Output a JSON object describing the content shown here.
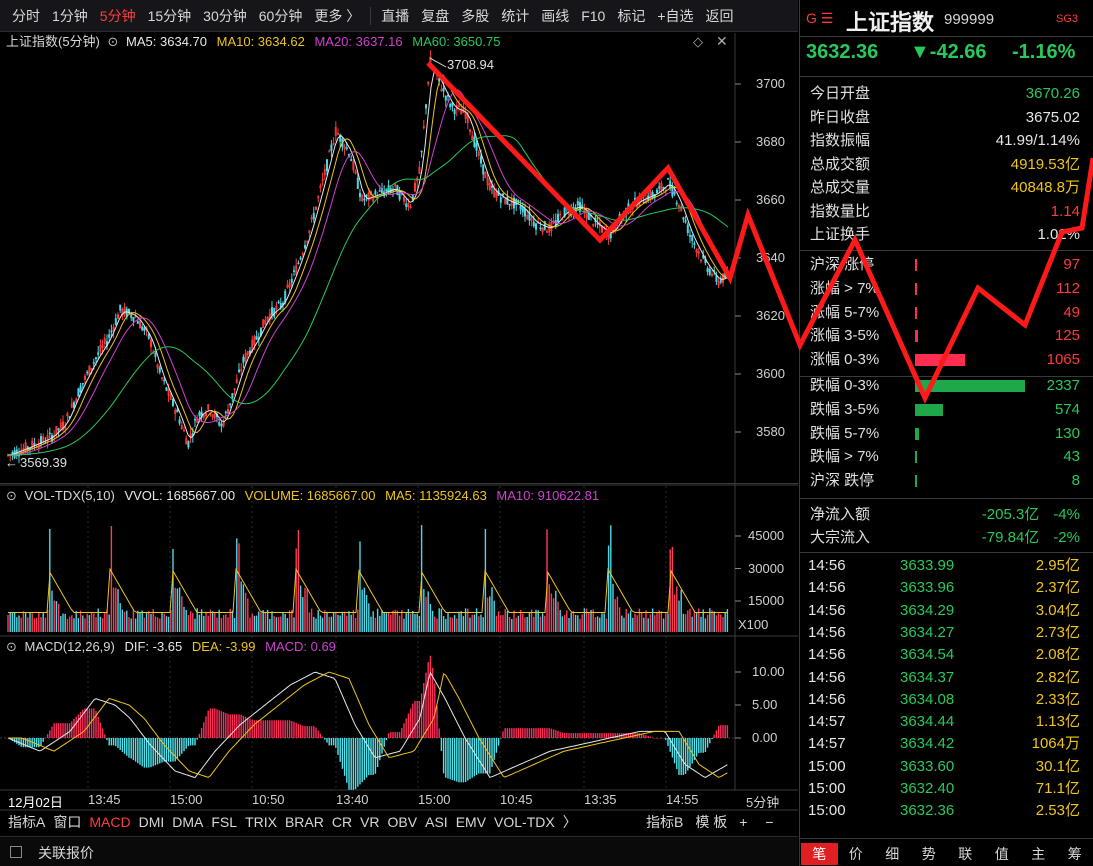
{
  "toolbar": {
    "periods": [
      "分时",
      "1分钟",
      "5分钟",
      "15分钟",
      "30分钟",
      "60分钟",
      "更多 〉"
    ],
    "active_period": "5分钟",
    "actions": [
      "直播",
      "复盘",
      "多股",
      "统计",
      "画线",
      "F10",
      "标记",
      "+自选",
      "返回"
    ]
  },
  "main_legend": {
    "name": "上证指数(5分钟)",
    "ma5": "MA5: 3634.70",
    "ma10": "MA10: 3634.62",
    "ma20": "MA20: 3637.16",
    "ma60": "MA60: 3650.75"
  },
  "price_axis": [
    "3700",
    "3680",
    "3660",
    "3640",
    "3620",
    "3600",
    "3580"
  ],
  "price_labels": {
    "high": "3708.94",
    "low": "3569.39"
  },
  "vol_legend": {
    "name": "VOL-TDX(5,10)",
    "vvol": "VVOL: 1685667.00",
    "volume": "VOLUME: 1685667.00",
    "ma5": "MA5: 1135924.63",
    "ma10": "MA10: 910622.81"
  },
  "vol_axis": [
    "45000",
    "30000",
    "15000"
  ],
  "vol_unit": "X100",
  "macd_legend": {
    "name": "MACD(12,26,9)",
    "dif": "DIF: -3.65",
    "dea": "DEA: -3.99",
    "macd": "MACD: 0.69"
  },
  "macd_axis": [
    "10.00",
    "5.00",
    "0.00"
  ],
  "time_axis": [
    "12月02日",
    "13:45",
    "15:00",
    "10:50",
    "13:40",
    "15:00",
    "10:45",
    "13:35",
    "14:55"
  ],
  "period_label": "5分钟",
  "indicator_tabs": [
    "指标A",
    "窗口",
    "MACD",
    "DMI",
    "DMA",
    "FSL",
    "TRIX",
    "BRAR",
    "CR",
    "VR",
    "OBV",
    "ASI",
    "EMV",
    "VOL-TDX",
    "〉"
  ],
  "active_indicator": "MACD",
  "indicator_right": [
    "指标B",
    "模 板",
    "+",
    "−"
  ],
  "footer": {
    "label": "关联报价"
  },
  "quote": {
    "badge": "G ☰",
    "name": "上证指数",
    "code": "999999",
    "tag": "SG3",
    "price": "3632.36",
    "change": "▼-42.66",
    "pct": "-1.16%",
    "stats": [
      {
        "label": "今日开盘",
        "value": "3670.26",
        "color": "green"
      },
      {
        "label": "昨日收盘",
        "value": "3675.02",
        "color": "white"
      },
      {
        "label": "指数振幅",
        "value": "41.99/1.14%",
        "color": "white"
      },
      {
        "label": "总成交额",
        "value": "4919.53亿",
        "color": "yellow"
      },
      {
        "label": "总成交量",
        "value": "40848.8万",
        "color": "yellow"
      },
      {
        "label": "指数量比",
        "value": "1.14",
        "color": "red"
      },
      {
        "label": "上证换手",
        "value": "1.02%",
        "color": "white"
      }
    ],
    "breadth": [
      {
        "label": "沪深 涨停",
        "value": "97",
        "color": "red",
        "bar": 0.02
      },
      {
        "label": "涨幅 > 7%",
        "value": "112",
        "color": "red",
        "bar": 0.02
      },
      {
        "label": "涨幅 5-7%",
        "value": "49",
        "color": "red",
        "bar": 0.01
      },
      {
        "label": "涨幅 3-5%",
        "value": "125",
        "color": "red",
        "bar": 0.03
      },
      {
        "label": "涨幅 0-3%",
        "value": "1065",
        "color": "red",
        "bar": 0.45
      },
      {
        "label": "跌幅 0-3%",
        "value": "2337",
        "color": "green",
        "bar": 1.0
      },
      {
        "label": "跌幅 3-5%",
        "value": "574",
        "color": "green",
        "bar": 0.25
      },
      {
        "label": "跌幅 5-7%",
        "value": "130",
        "color": "green",
        "bar": 0.04
      },
      {
        "label": "跌幅 > 7%",
        "value": "43",
        "color": "green",
        "bar": 0.01
      },
      {
        "label": "沪深 跌停",
        "value": "8",
        "color": "green",
        "bar": 0.005
      }
    ],
    "flows": [
      {
        "label": "净流入额",
        "value": "-205.3亿",
        "pct": "-4%"
      },
      {
        "label": "大宗流入",
        "value": "-79.84亿",
        "pct": "-2%"
      }
    ],
    "ticks": [
      {
        "t": "14:56",
        "p": "3633.99",
        "a": "2.95亿"
      },
      {
        "t": "14:56",
        "p": "3633.96",
        "a": "2.37亿"
      },
      {
        "t": "14:56",
        "p": "3634.29",
        "a": "3.04亿"
      },
      {
        "t": "14:56",
        "p": "3634.27",
        "a": "2.73亿"
      },
      {
        "t": "14:56",
        "p": "3634.54",
        "a": "2.08亿"
      },
      {
        "t": "14:56",
        "p": "3634.37",
        "a": "2.82亿"
      },
      {
        "t": "14:56",
        "p": "3634.08",
        "a": "2.33亿"
      },
      {
        "t": "14:57",
        "p": "3634.44",
        "a": "1.13亿"
      },
      {
        "t": "14:57",
        "p": "3634.42",
        "a": "1064万"
      },
      {
        "t": "15:00",
        "p": "3633.60",
        "a": "30.1亿"
      },
      {
        "t": "15:00",
        "p": "3632.40",
        "a": "71.1亿"
      },
      {
        "t": "15:00",
        "p": "3632.36",
        "a": "2.53亿"
      }
    ],
    "tabs": [
      "笔",
      "价",
      "细",
      "势",
      "联",
      "值",
      "主",
      "筹"
    ],
    "active_tab": "笔"
  }
}
